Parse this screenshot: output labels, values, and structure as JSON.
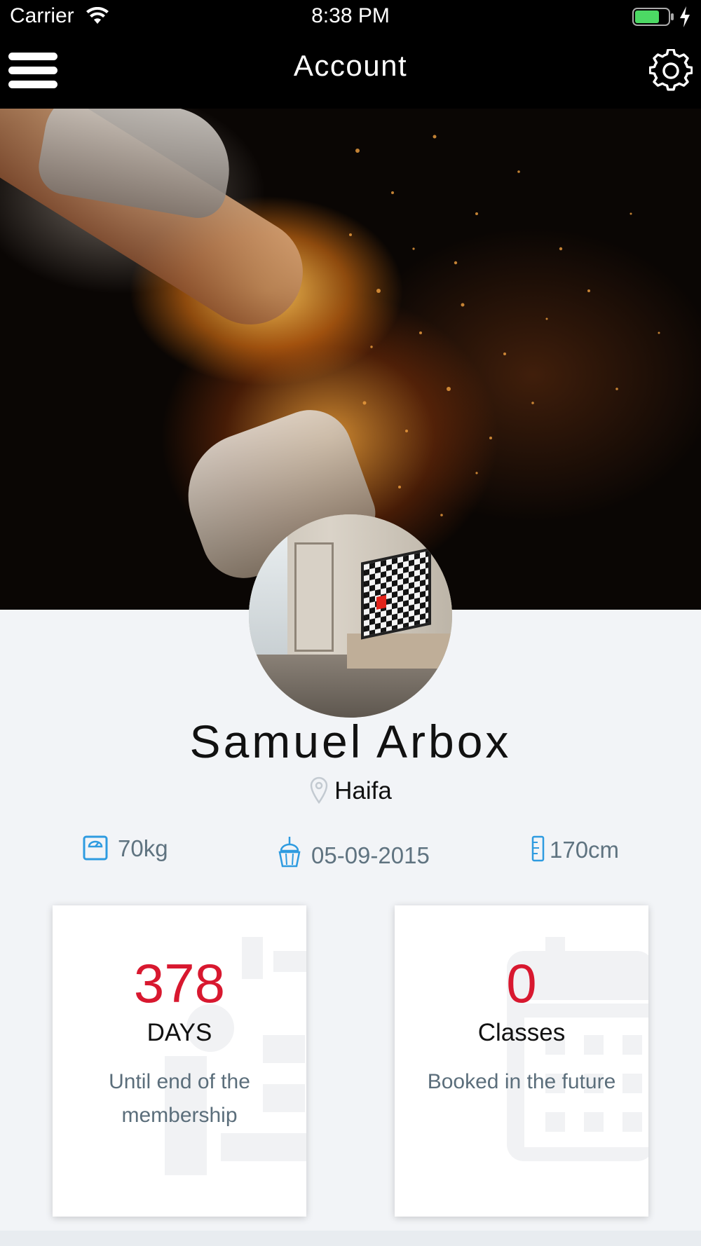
{
  "status_bar": {
    "carrier": "Carrier",
    "time": "8:38 PM"
  },
  "nav": {
    "title": "Account",
    "menu_icon": "hamburger-menu-icon",
    "settings_icon": "gear-icon"
  },
  "profile": {
    "name": "Samuel Arbox",
    "location": "Haifa",
    "weight": "70kg",
    "birthdate": "05-09-2015",
    "height": "170cm"
  },
  "cards": [
    {
      "value": "378",
      "unit": "DAYS",
      "description": "Until end of the membership",
      "icon": "calendar-person-icon"
    },
    {
      "value": "0",
      "unit": "Classes",
      "description": "Booked in the future",
      "icon": "calendar-grid-icon"
    }
  ],
  "colors": {
    "accent_red": "#d8182f",
    "icon_blue": "#2e9be0",
    "secondary_text": "#5f7380",
    "background": "#f2f4f7"
  }
}
